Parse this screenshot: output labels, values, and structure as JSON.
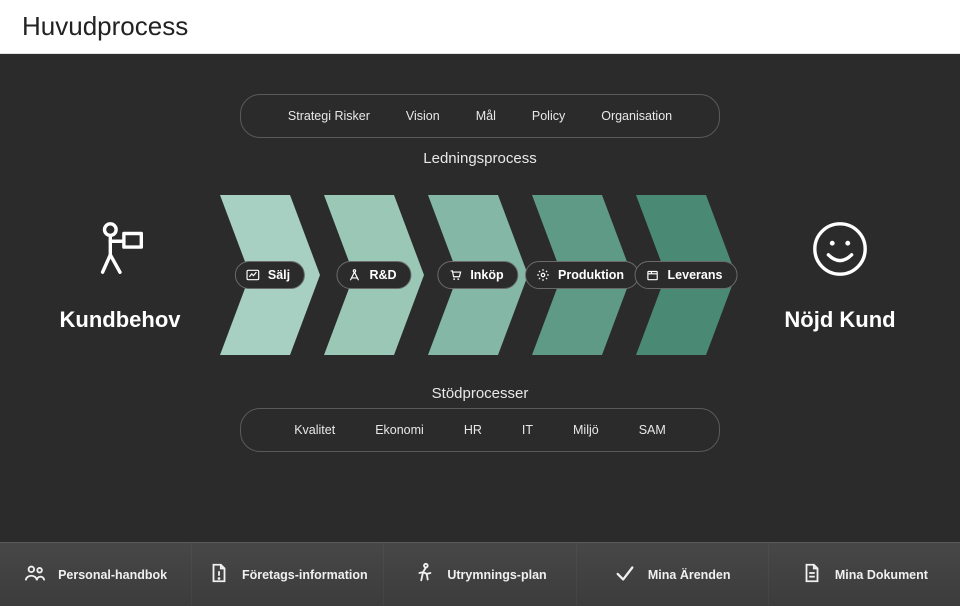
{
  "header": {
    "title": "Huvudprocess"
  },
  "management": {
    "label": "Ledningsprocess",
    "items": [
      "Strategi Risker",
      "Vision",
      "Mål",
      "Policy",
      "Organisation"
    ]
  },
  "support": {
    "label": "Stödprocesser",
    "items": [
      "Kvalitet",
      "Ekonomi",
      "HR",
      "IT",
      "Miljö",
      "SAM"
    ]
  },
  "left": {
    "caption": "Kundbehov"
  },
  "right": {
    "caption": "Nöjd Kund"
  },
  "core": {
    "steps": [
      {
        "label": "Sälj",
        "icon": "chart-icon",
        "color": "#a7cfc2"
      },
      {
        "label": "R&D",
        "icon": "compass-icon",
        "color": "#9bc7b7"
      },
      {
        "label": "Inköp",
        "icon": "cart-icon",
        "color": "#84b7a5"
      },
      {
        "label": "Produktion",
        "icon": "gear-icon",
        "color": "#5f9a86"
      },
      {
        "label": "Leverans",
        "icon": "package-icon",
        "color": "#4a8a74"
      }
    ]
  },
  "footer": {
    "items": [
      {
        "label": "Personal-handbok",
        "icon": "people-icon"
      },
      {
        "label": "Företags-information",
        "icon": "doc-alert-icon"
      },
      {
        "label": "Utrymnings-plan",
        "icon": "run-icon"
      },
      {
        "label": "Mina Ärenden",
        "icon": "check-icon"
      },
      {
        "label": "Mina Dokument",
        "icon": "doc-lines-icon"
      }
    ]
  }
}
